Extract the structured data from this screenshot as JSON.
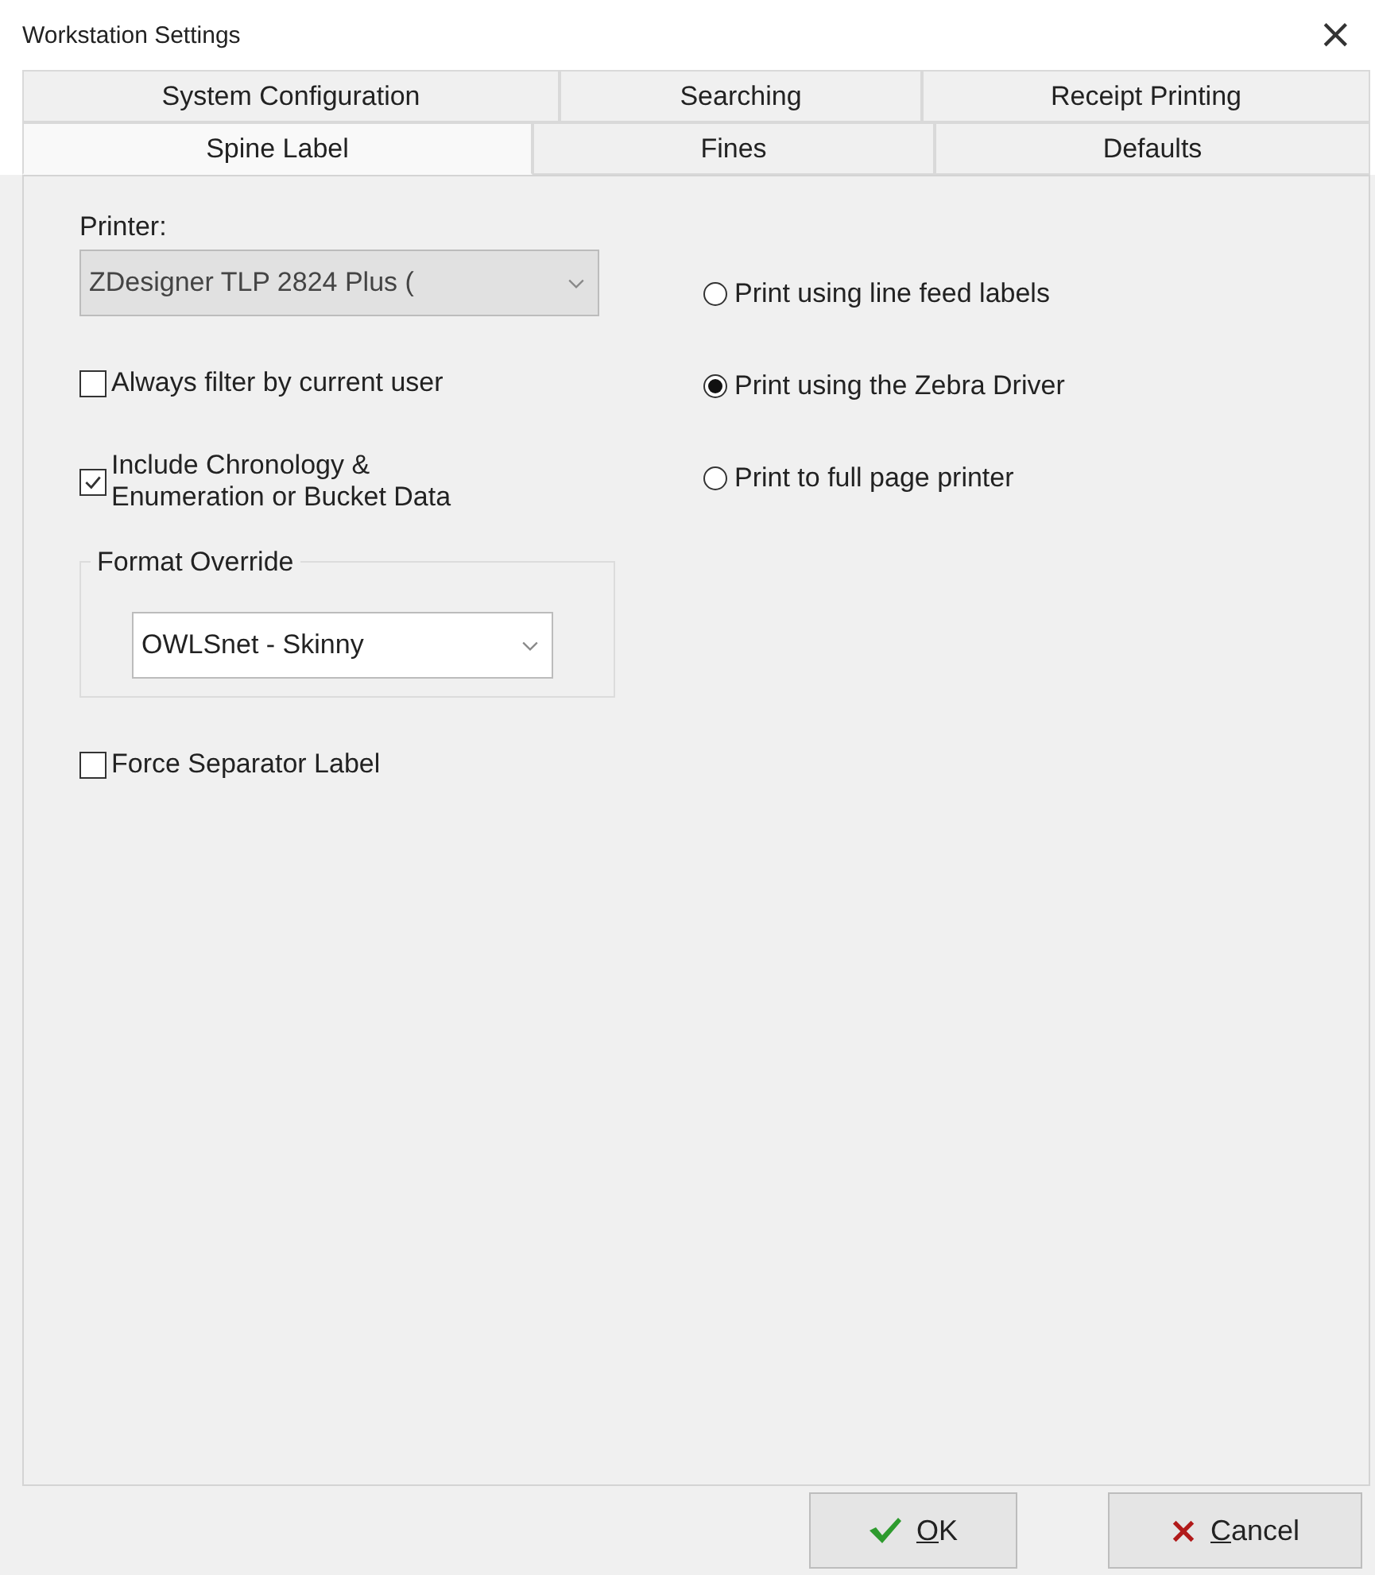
{
  "window": {
    "title": "Workstation Settings",
    "close": "×"
  },
  "tab_rows": [
    {
      "tabs": [
        {
          "label": "System Configuration",
          "selected": false
        },
        {
          "label": "Searching",
          "selected": false
        },
        {
          "label": "Receipt Printing",
          "selected": false
        }
      ]
    },
    {
      "tabs": [
        {
          "label": "Spine Label",
          "selected": true
        },
        {
          "label": "Fines",
          "selected": false
        },
        {
          "label": "Defaults",
          "selected": false
        }
      ]
    }
  ],
  "printer": {
    "label": "Printer:",
    "value": "ZDesigner TLP 2824 Plus (",
    "disabled": true
  },
  "checkboxes": [
    {
      "label": "Always filter by current user",
      "checked": false
    },
    {
      "label": "Include Chronology &\nEnumeration or Bucket Data",
      "checked": true
    }
  ],
  "format_override": {
    "legend": "Format Override",
    "value": "OWLSnet - Skinny"
  },
  "force_separator": {
    "label": "Force Separator Label",
    "checked": false
  },
  "print_modes": [
    {
      "label": "Print using line feed labels",
      "selected": false
    },
    {
      "label": "Print using the Zebra Driver",
      "selected": true
    },
    {
      "label": "Print to full page printer",
      "selected": false
    }
  ],
  "buttons": [
    {
      "label": "OK",
      "kind": "ok"
    },
    {
      "label": "Cancel",
      "kind": "cancel"
    }
  ]
}
